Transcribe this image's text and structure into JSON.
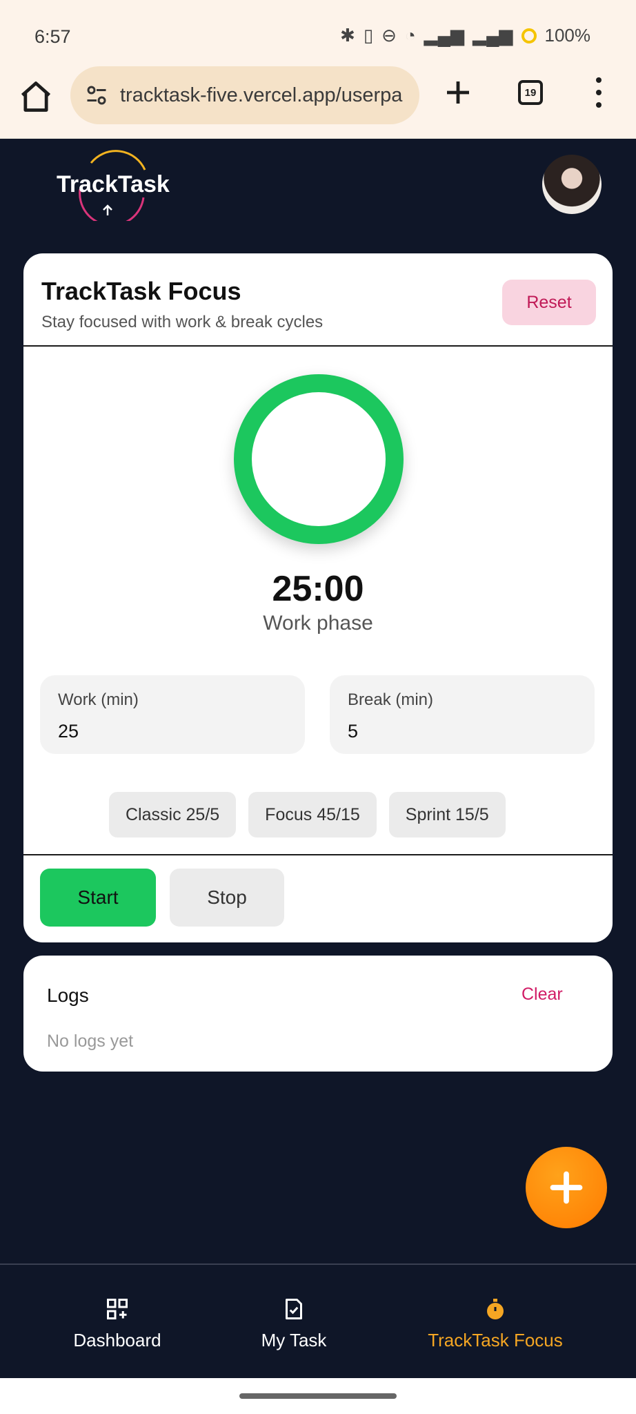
{
  "status_bar": {
    "time": "6:57",
    "battery": "100%"
  },
  "browser": {
    "url": "tracktask-five.vercel.app/userpa",
    "tab_count": "19"
  },
  "app": {
    "logo_text": "TrackTask"
  },
  "focus": {
    "title": "TrackTask Focus",
    "subtitle": "Stay focused with work & break cycles",
    "reset_label": "Reset",
    "timer": "25:00",
    "phase": "Work phase",
    "progress": 1.0,
    "work": {
      "label": "Work (min)",
      "value": "25"
    },
    "break": {
      "label": "Break (min)",
      "value": "5"
    },
    "presets": [
      "Classic 25/5",
      "Focus 45/15",
      "Sprint 15/5"
    ],
    "start_label": "Start",
    "stop_label": "Stop"
  },
  "logs": {
    "title": "Logs",
    "clear_label": "Clear",
    "empty_text": "No logs yet"
  },
  "fab": {
    "icon": "plus-icon"
  },
  "nav": [
    {
      "label": "Dashboard",
      "icon": "dashboard-icon",
      "active": false
    },
    {
      "label": "My Task",
      "icon": "task-check-icon",
      "active": false
    },
    {
      "label": "TrackTask Focus",
      "icon": "stopwatch-icon",
      "active": true
    }
  ],
  "colors": {
    "accent": "#1cc75e",
    "active_nav": "#f5a623",
    "danger": "#c01956",
    "fab": "#ff8a00"
  }
}
